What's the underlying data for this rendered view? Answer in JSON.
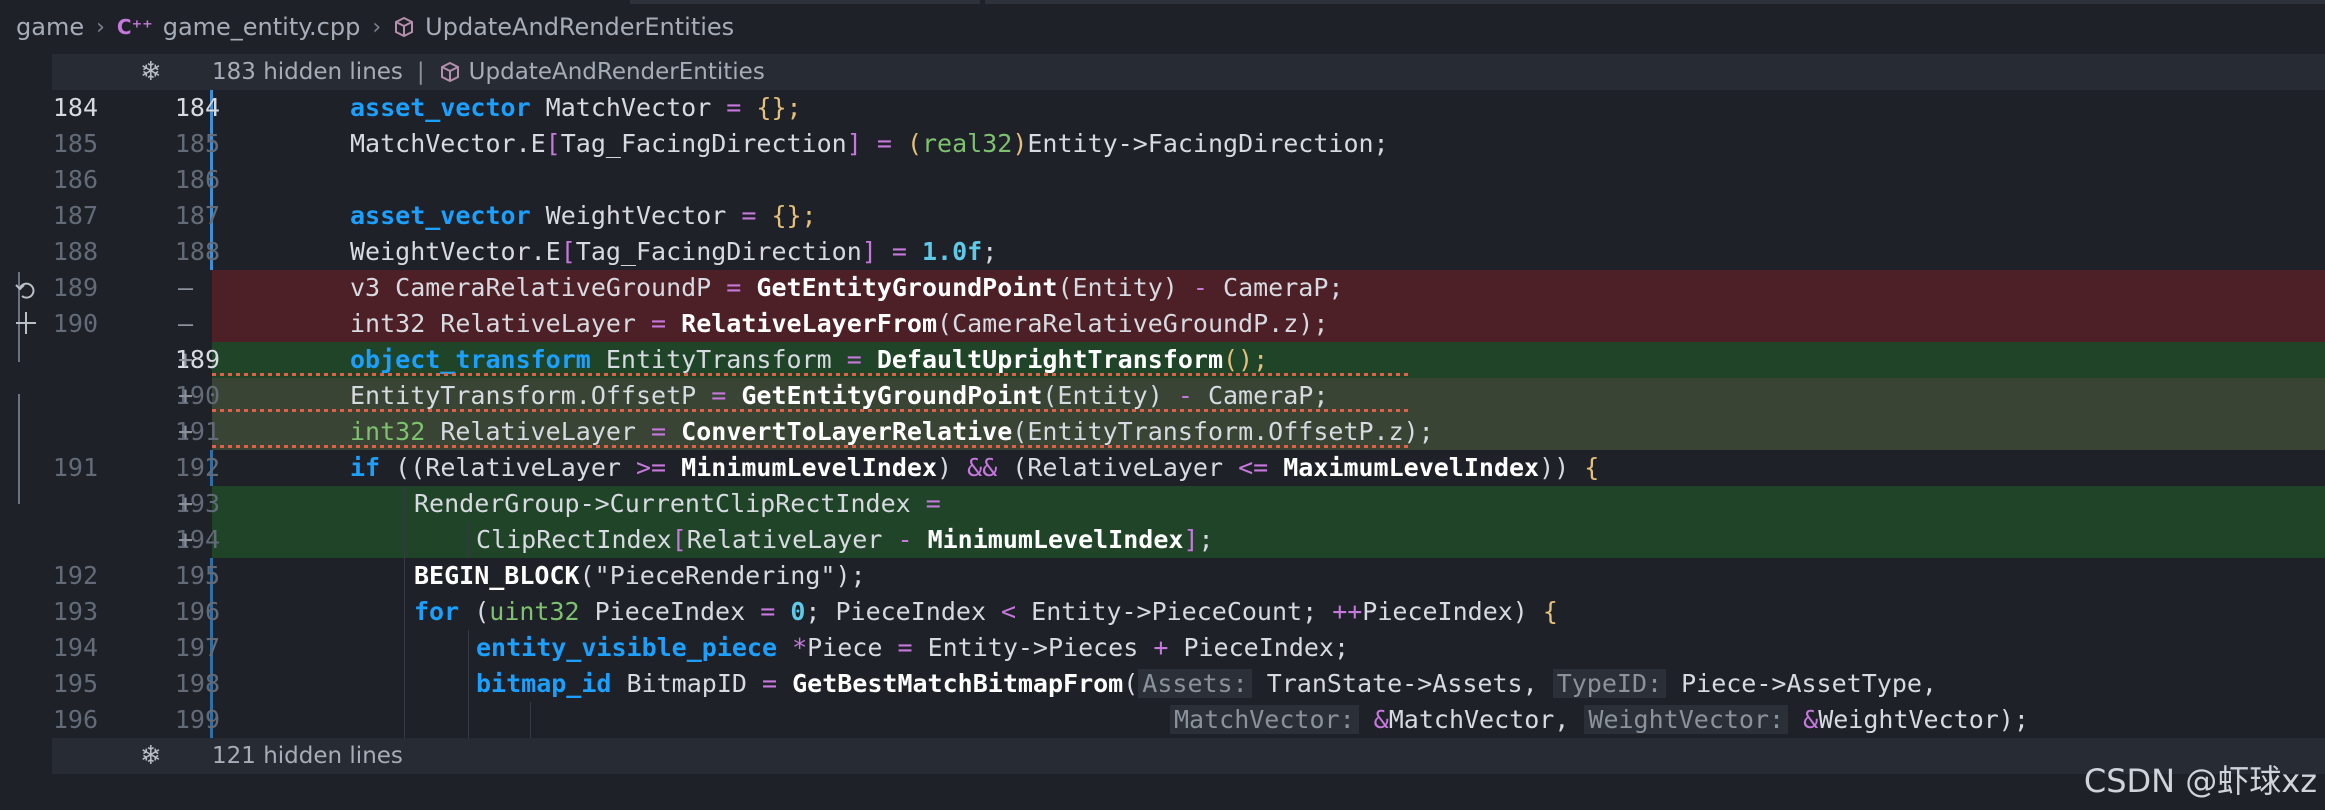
{
  "breadcrumb": {
    "folder": "game",
    "file_icon": "c++-file-icon",
    "file": "game_entity.cpp",
    "symbol": "UpdateAndRenderEntities"
  },
  "fold_top": {
    "hidden": "183 hidden lines",
    "separator": "|",
    "symbol": "UpdateAndRenderEntities"
  },
  "fold_bottom": {
    "hidden": "121 hidden lines"
  },
  "watermark": "CSDN @虾球xz",
  "colors": {
    "background": "#1e2127",
    "deleted": "#4d1f27",
    "added": "#1f4427",
    "keyword": "#1ca0ff",
    "type": "#7ec16e",
    "operator": "#c678dd",
    "number": "#5fc9e8"
  },
  "lines": [
    {
      "old": "184",
      "new": "184",
      "mark": "",
      "type": "ctx"
    },
    {
      "old": "185",
      "new": "185",
      "mark": "",
      "type": "ctx"
    },
    {
      "old": "186",
      "new": "186",
      "mark": "",
      "type": "ctx"
    },
    {
      "old": "187",
      "new": "187",
      "mark": "",
      "type": "ctx"
    },
    {
      "old": "188",
      "new": "188",
      "mark": "",
      "type": "ctx"
    },
    {
      "old": "189",
      "new": "",
      "mark": "—",
      "type": "del"
    },
    {
      "old": "190",
      "new": "",
      "mark": "—",
      "type": "del"
    },
    {
      "old": "",
      "new": "189",
      "mark": "+",
      "type": "add"
    },
    {
      "old": "",
      "new": "190",
      "mark": "+",
      "type": "addm"
    },
    {
      "old": "",
      "new": "191",
      "mark": "+",
      "type": "addm"
    },
    {
      "old": "191",
      "new": "192",
      "mark": "",
      "type": "ctx"
    },
    {
      "old": "",
      "new": "193",
      "mark": "+",
      "type": "add"
    },
    {
      "old": "",
      "new": "194",
      "mark": "+",
      "type": "add"
    },
    {
      "old": "192",
      "new": "195",
      "mark": "",
      "type": "ctx"
    },
    {
      "old": "193",
      "new": "196",
      "mark": "",
      "type": "ctx"
    },
    {
      "old": "194",
      "new": "197",
      "mark": "",
      "type": "ctx"
    },
    {
      "old": "195",
      "new": "198",
      "mark": "",
      "type": "ctx"
    },
    {
      "old": "196",
      "new": "199",
      "mark": "",
      "type": "ctx"
    }
  ],
  "code": {
    "l184": {
      "kw": "asset_vector",
      "rest": " MatchVector ",
      "op": "=",
      "br": " {};"
    },
    "l185": {
      "a": "MatchVector.E",
      "b1": "[",
      "c": "Tag_FacingDirection",
      "b2": "]",
      "op": " = ",
      "p1": "(",
      "ty": "real32",
      "p2": ")",
      "d": "Entity->FacingDirection;"
    },
    "l187": {
      "kw": "asset_vector",
      "rest": " WeightVector ",
      "op": "=",
      "br": " {};"
    },
    "l188": {
      "a": "WeightVector.E",
      "b1": "[",
      "c": "Tag_FacingDirection",
      "b2": "]",
      "op": " = ",
      "num": "1.0f",
      "semi": ";"
    },
    "d189": {
      "a": "v3 CameraRelativeGroundP ",
      "op": "=",
      "fn": " GetEntityGroundPoint",
      "b": "(Entity) ",
      "op2": "-",
      "c": " CameraP;"
    },
    "d190": {
      "a": "int32 RelativeLayer ",
      "op": "=",
      "fn": " RelativeLayerFrom",
      "b": "(CameraRelativeGroundP.z);"
    },
    "a189": {
      "kw": "object_transform",
      "a": " EntityTransform ",
      "op": "=",
      "fn": " DefaultUprightTransform",
      "b": "();"
    },
    "a190": {
      "a": "EntityTransform.OffsetP ",
      "op": "=",
      "fn": " GetEntityGroundPoint",
      "b": "(Entity) ",
      "op2": "-",
      "c": " CameraP;"
    },
    "a191": {
      "ty": "int32",
      "a": " RelativeLayer ",
      "op": "=",
      "fn": " ConvertToLayerRelative",
      "b": "(EntityTransform.OffsetP.z);"
    },
    "l192": {
      "kw": "if",
      "a": " ((RelativeLayer ",
      "op": ">=",
      "fn": " MinimumLevelIndex",
      "b": ") ",
      "op2": "&&",
      "c": " (RelativeLayer ",
      "op3": "<=",
      "fn2": " MaximumLevelIndex",
      "d": ")) ",
      "br": "{"
    },
    "a193": {
      "a": "RenderGroup->CurrentClipRectIndex ",
      "op": "="
    },
    "a194": {
      "a": "ClipRectIndex",
      "b1": "[",
      "c": "RelativeLayer ",
      "op": "-",
      "fn": " MinimumLevelIndex",
      "b2": "]",
      "semi": ";"
    },
    "l195": {
      "fn": "BEGIN_BLOCK",
      "a": "(",
      "str": "\"PieceRendering\"",
      "b": ");"
    },
    "l196": {
      "kw": "for",
      "a": " (",
      "ty": "uint32",
      "b": " PieceIndex ",
      "op": "=",
      "num": " 0",
      "c": "; PieceIndex ",
      "op2": "<",
      "d": " Entity->PieceCount; ",
      "op3": "++",
      "e": "PieceIndex) ",
      "br": "{"
    },
    "l197": {
      "kw": "entity_visible_piece",
      "op": " *",
      "a": "Piece ",
      "op2": "=",
      "b": " Entity->Pieces ",
      "op3": "+",
      "c": " PieceIndex;"
    },
    "l198": {
      "kw": "bitmap_id",
      "a": " BitmapID ",
      "op": "=",
      "fn": " GetBestMatchBitmapFrom",
      "b": "(",
      "h1": "Assets:",
      "c": " TranState->Assets, ",
      "h2": "TypeID:",
      "d": " Piece->AssetType,"
    },
    "l199": {
      "h3": "MatchVector:",
      "op": " &",
      "a": "MatchVector, ",
      "h4": "WeightVector:",
      "op2": " &",
      "b": "WeightVector);"
    }
  }
}
